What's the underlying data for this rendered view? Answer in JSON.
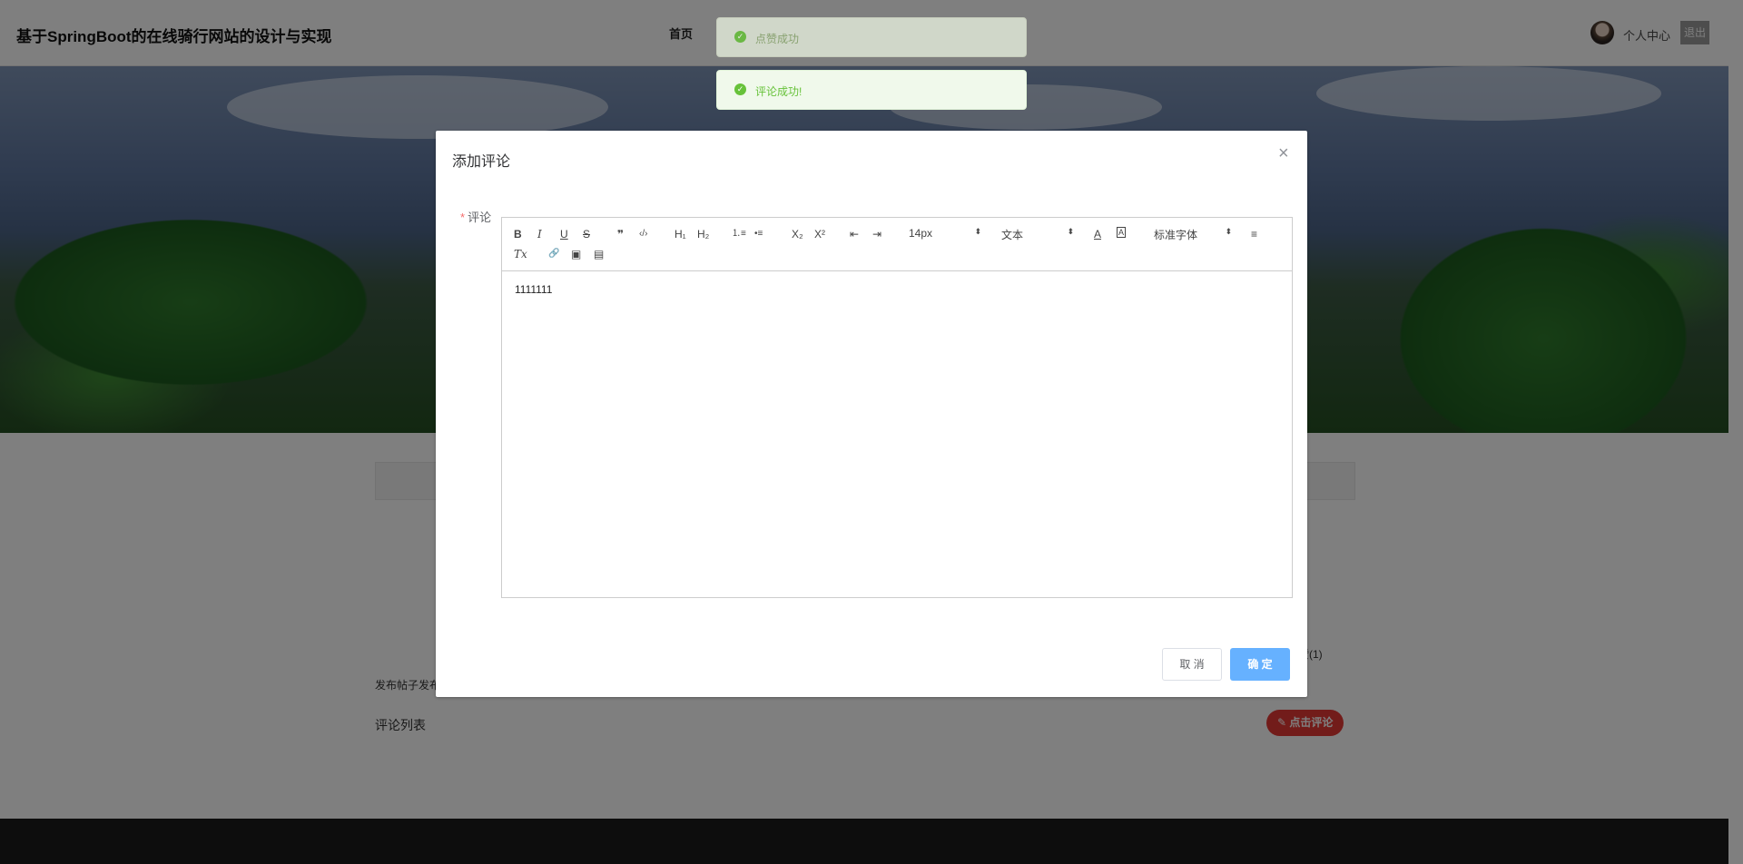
{
  "header": {
    "site_title": "基于SpringBoot的在线骑行网站的设计与实现",
    "nav_home": "首页",
    "user_center": "个人中心",
    "logout": "退出"
  },
  "page": {
    "likes_text": "赞(1)",
    "post_info": "发布帖子发布",
    "comment_list_title": "评论列表",
    "comment_button": "点击评论"
  },
  "toasts": [
    {
      "message": "点赞成功"
    },
    {
      "message": "评论成功!"
    }
  ],
  "dialog": {
    "title": "添加评论",
    "close_icon": "×",
    "field_label": "评论",
    "required_mark": "*",
    "editor": {
      "toolbar": {
        "bold": "B",
        "italic": "I",
        "underline": "U",
        "strike": "S",
        "blockquote": "❞",
        "code": "‹/›",
        "h1": "H₁",
        "h2": "H₂",
        "ordered_list": "⒈≡",
        "bullet_list": "•≡",
        "subscript": "X₂",
        "superscript": "X²",
        "outdent": "⇤",
        "indent": "⇥",
        "font_size": "14px",
        "header_select": "文本",
        "font_family": "标准字体",
        "font_color_icon": "A",
        "background_color_icon": "A",
        "align_icon": "≡",
        "clean": "Tx",
        "link_icon": "🔗",
        "image_icon": "▣",
        "video_icon": "▤"
      },
      "content": "1111111"
    },
    "cancel": "取 消",
    "confirm": "确 定"
  },
  "colors": {
    "primary": "#409eff",
    "confirm_button": "#66b1ff",
    "danger": "#e53935",
    "success": "#67c23a"
  }
}
